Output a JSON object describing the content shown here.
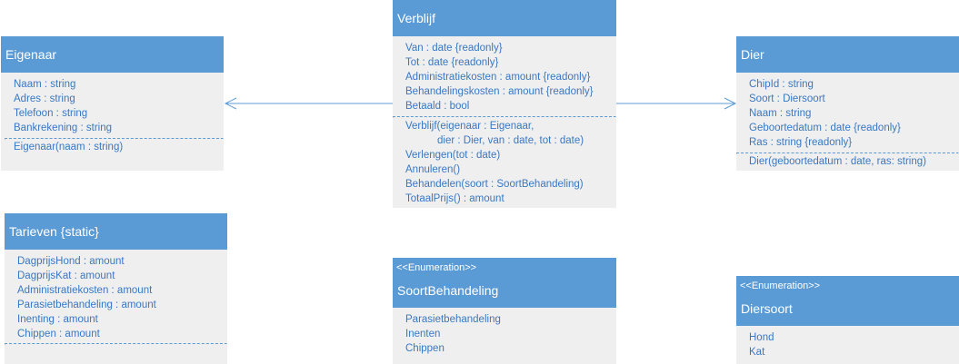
{
  "classes": {
    "eigenaar": {
      "name": "Eigenaar",
      "attributes": [
        "Naam : string",
        "Adres : string",
        "Telefoon : string",
        "Bankrekening : string"
      ],
      "methods": [
        "Eigenaar(naam : string)"
      ]
    },
    "verblijf": {
      "name": "Verblijf",
      "attributes": [
        "Van : date {readonly}",
        "Tot : date {readonly}",
        "Administratiekosten : amount {readonly}",
        "Behandelingskosten : amount {readonly}",
        "Betaald : bool"
      ],
      "methods": [
        "Verblijf(eigenaar : Eigenaar,",
        "dier : Dier, van : date, tot : date)",
        "Verlengen(tot : date)",
        "Annuleren()",
        "Behandelen(soort : SoortBehandeling)",
        "TotaalPrijs() : amount"
      ]
    },
    "dier": {
      "name": "Dier",
      "attributes": [
        "ChipId : string",
        "Soort : Diersoort",
        "Naam : string",
        "Geboortedatum : date {readonly}",
        "Ras : string {readonly}"
      ],
      "methods": [
        "Dier(geboortedatum : date,  ras: string)"
      ]
    },
    "tarieven": {
      "name": "Tarieven {static}",
      "attributes": [
        "DagprijsHond : amount",
        "DagprijsKat : amount",
        "Administratiekosten : amount",
        "Parasietbehandeling : amount",
        "Inenting : amount",
        "Chippen : amount"
      ]
    },
    "soortbehandeling": {
      "stereotype": "<<Enumeration>>",
      "name": "SoortBehandeling",
      "values": [
        "Parasietbehandeling",
        "Inenten",
        "Chippen"
      ]
    },
    "diersoort": {
      "stereotype": "<<Enumeration>>",
      "name": "Diersoort",
      "values": [
        "Hond",
        "Kat"
      ]
    }
  },
  "colors": {
    "header": "#5b9bd5",
    "body": "#efefef",
    "text": "#3a78c2",
    "line": "#5b9bd5"
  }
}
